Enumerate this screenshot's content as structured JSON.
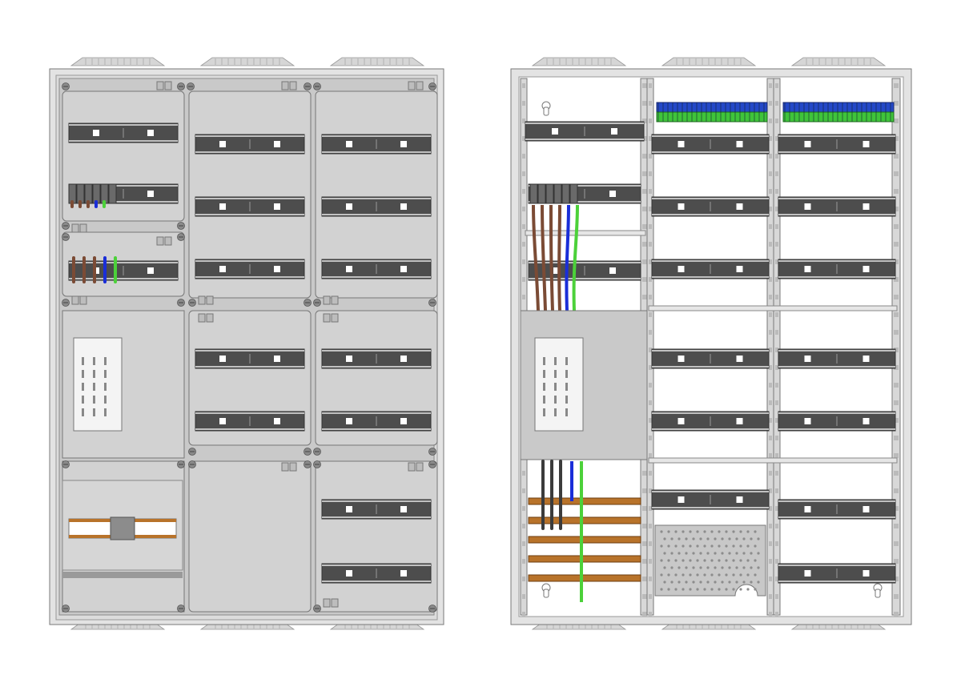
{
  "figure": {
    "views": [
      "front-covered",
      "interior-open"
    ],
    "colors": {
      "background": "#ffffff",
      "frame": "#e3e3e3",
      "frame_stroke": "#7a7a7a",
      "cover_panel": "#c9c9c9",
      "panel_fill": "#d2d2d2",
      "interior": "#ffffff",
      "din_rail": "#4d4d4d",
      "din_rail_edge": "#e8e8e8",
      "rail_slot": "#ffffff",
      "vent_top": "#d6d6d6",
      "screw": "#8a8a8a",
      "wire_brown": "#7b4b35",
      "wire_blue": "#1a2ed8",
      "wire_green": "#4cd13a",
      "busbar_copper": "#b8732a",
      "terminal_blue": "#2448c8",
      "terminal_green": "#3fc43a",
      "perforated_plate": "#c8c8c8"
    },
    "icons": [
      "screw-icon",
      "keyhole-icon",
      "terminal-block-icon",
      "vent-icon"
    ]
  }
}
